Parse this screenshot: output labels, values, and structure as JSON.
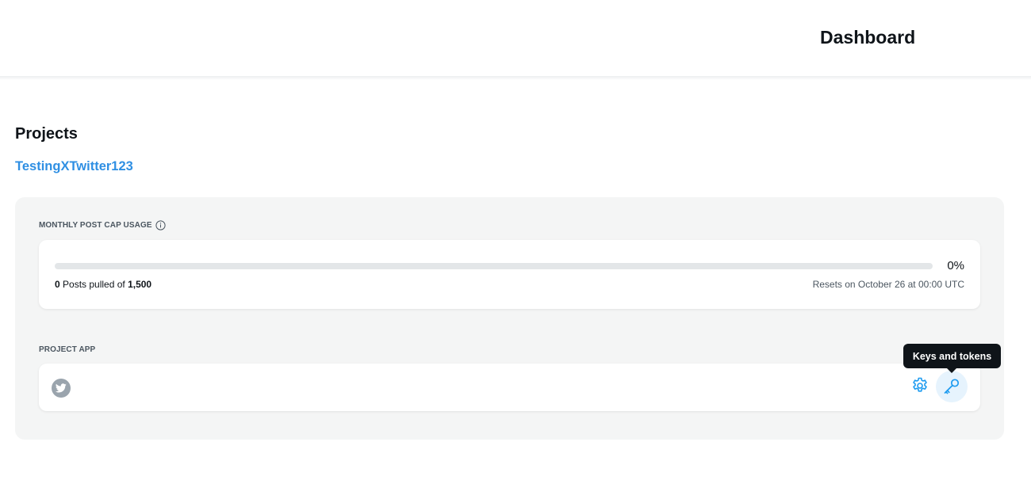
{
  "header": {
    "title": "Dashboard"
  },
  "projects": {
    "section_title": "Projects",
    "project_name": "TestingXTwitter123"
  },
  "usage": {
    "label": "MONTHLY POST CAP USAGE",
    "percent_text": "0%",
    "percent_value": 0,
    "pulled": "0",
    "pulled_middle": " Posts pulled of ",
    "cap": "1,500",
    "reset_text": "Resets on October 26 at 00:00 UTC"
  },
  "project_app": {
    "label": "PROJECT APP",
    "settings_icon": "gear-icon",
    "keys_icon": "key-icon",
    "tooltip": "Keys and tokens"
  },
  "colors": {
    "accent": "#1d9bf0",
    "link": "#2f8fe3",
    "panel_bg": "#f4f5f5",
    "tooltip_bg": "#0f1419"
  }
}
